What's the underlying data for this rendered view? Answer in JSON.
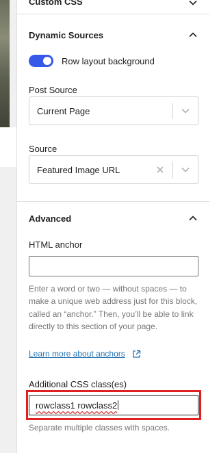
{
  "panels": {
    "custom_css": {
      "title": "Custom CSS"
    },
    "dynamic_sources": {
      "title": "Dynamic Sources",
      "toggle_label": "Row layout background",
      "toggle_on": true,
      "post_source": {
        "label": "Post Source",
        "value": "Current Page"
      },
      "source": {
        "label": "Source",
        "value": "Featured Image URL"
      }
    },
    "advanced": {
      "title": "Advanced",
      "html_anchor": {
        "label": "HTML anchor",
        "value": "",
        "help": "Enter a word or two — without spaces — to make a unique web address just for this block, called an “anchor.” Then, you’ll be able to link directly to this section of your page.",
        "link": "Learn more about anchors"
      },
      "css_class": {
        "label": "Additional CSS class(es)",
        "value": "rowclass1 rowclass2",
        "help": "Separate multiple classes with spaces."
      }
    }
  },
  "colors": {
    "accent": "#3858e9",
    "highlight": "#e02020",
    "link": "#2271b1"
  }
}
